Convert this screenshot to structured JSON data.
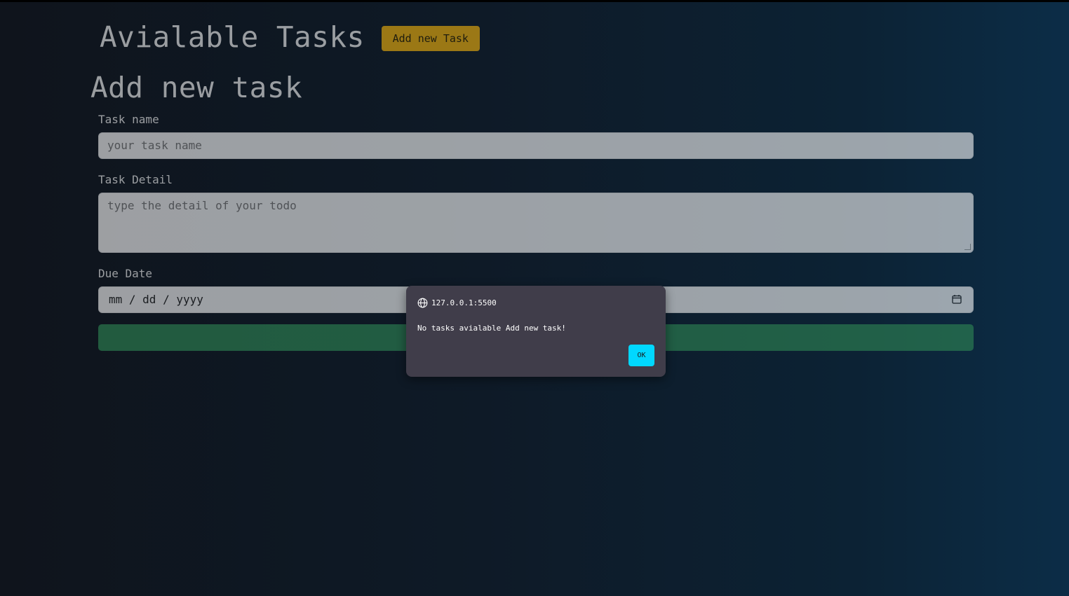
{
  "header": {
    "title": "Avialable Tasks",
    "add_button_label": "Add new Task"
  },
  "form": {
    "title": "Add new task",
    "task_name_label": "Task name",
    "task_name_placeholder": "your task name",
    "task_detail_label": "Task Detail",
    "task_detail_placeholder": "type the detail of your todo",
    "due_date_label": "Due Date",
    "due_date_placeholder": "mm / dd / yyyy",
    "submit_label": ""
  },
  "dialog": {
    "origin": "127.0.0.1:5500",
    "message": "No tasks avialable Add new task!",
    "ok_label": "OK"
  },
  "colors": {
    "accent_yellow": "#f2b20c",
    "submit_green": "#2e8654",
    "dialog_bg": "#403d4a",
    "ok_cyan": "#00d8ff"
  },
  "icons": {
    "calendar": "calendar-icon",
    "globe": "globe-icon"
  }
}
